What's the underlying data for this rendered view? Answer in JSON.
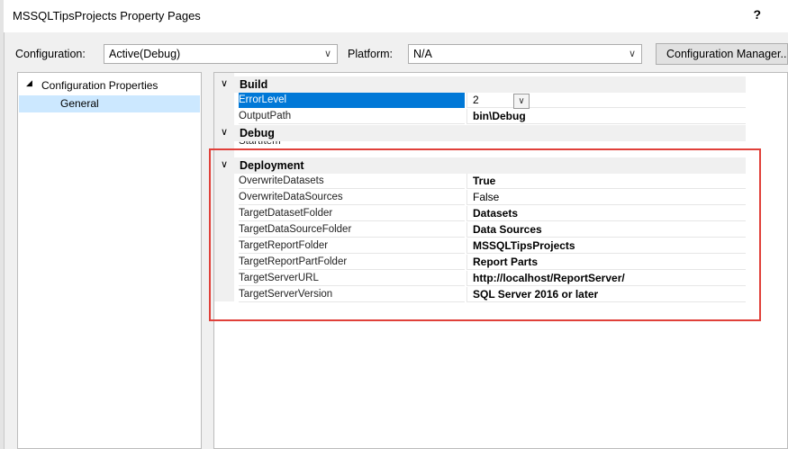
{
  "window": {
    "title": "MSSQLTipsProjects Property Pages",
    "help": "?"
  },
  "toolbar": {
    "configuration_label": "Configuration:",
    "configuration_value": "Active(Debug)",
    "platform_label": "Platform:",
    "platform_value": "N/A",
    "config_manager_label": "Configuration Manager..."
  },
  "tree": {
    "root": "Configuration Properties",
    "child": "General"
  },
  "grid": {
    "build": {
      "title": "Build",
      "rows": [
        {
          "name": "ErrorLevel",
          "value": "2"
        },
        {
          "name": "OutputPath",
          "value": "bin\\Debug"
        }
      ]
    },
    "debug": {
      "title": "Debug",
      "rows": [
        {
          "name": "StartItem",
          "value": ""
        }
      ]
    },
    "deployment": {
      "title": "Deployment",
      "rows": [
        {
          "name": "OverwriteDatasets",
          "value": "True"
        },
        {
          "name": "OverwriteDataSources",
          "value": "False"
        },
        {
          "name": "TargetDatasetFolder",
          "value": "Datasets"
        },
        {
          "name": "TargetDataSourceFolder",
          "value": "Data Sources"
        },
        {
          "name": "TargetReportFolder",
          "value": "MSSQLTipsProjects"
        },
        {
          "name": "TargetReportPartFolder",
          "value": "Report Parts"
        },
        {
          "name": "TargetServerURL",
          "value": "http://localhost/ReportServer/"
        },
        {
          "name": "TargetServerVersion",
          "value": "SQL Server 2016 or later"
        }
      ]
    }
  },
  "colors": {
    "highlight": "#e0403a",
    "selection": "#0078d7"
  }
}
